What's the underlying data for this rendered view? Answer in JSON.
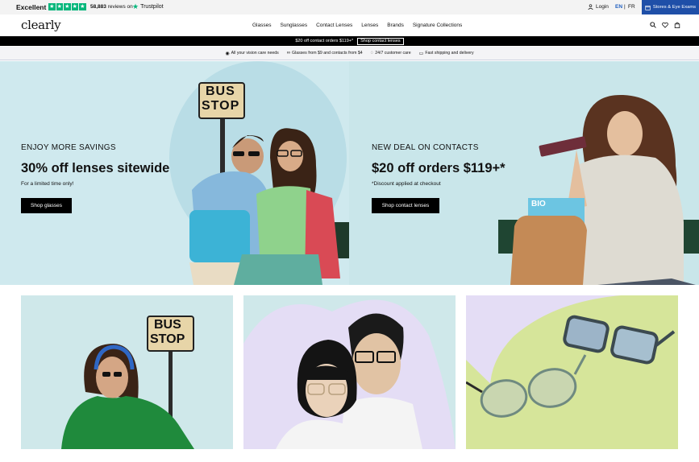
{
  "topbar": {
    "rating": "Excellent",
    "reviews_count": "58,883",
    "reviews_suffix": "reviews on",
    "trustpilot": "Trustpilot",
    "login": "Login",
    "lang_en": "EN",
    "lang_sep": "|",
    "lang_fr": "FR",
    "stores": "Stores & Eye Exams"
  },
  "header": {
    "logo": "clearly",
    "nav": [
      "Glasses",
      "Sunglasses",
      "Contact Lenses",
      "Lenses",
      "Brands",
      "Signature Collections"
    ],
    "icons": [
      "search-icon",
      "heart-icon",
      "bag-icon"
    ]
  },
  "promo": {
    "text": "$20 off contact orders $119+*",
    "button": "Shop contact lenses"
  },
  "benefits": [
    {
      "icon": "eye-icon",
      "text": "All your vision care needs"
    },
    {
      "icon": "glasses-icon",
      "text": "Glasses from $9 and contacts from $4"
    },
    {
      "icon": "headset-icon",
      "text": "24/7 customer care"
    },
    {
      "icon": "box-icon",
      "text": "Fast shipping and delivery"
    }
  ],
  "hero_left": {
    "eyebrow": "ENJOY MORE SAVINGS",
    "title": "30% off lenses sitewide",
    "sub": "For a limited time only!",
    "button": "Shop glasses",
    "sign": [
      "BUS",
      "STOP"
    ]
  },
  "hero_right": {
    "eyebrow": "NEW DEAL ON CONTACTS",
    "title": "$20 off orders $119+*",
    "sub": "*Discount applied at checkout",
    "button": "Shop contact lenses",
    "box_text": "BIO"
  },
  "cards": {
    "card1_sign": [
      "BUS",
      "STOP"
    ]
  },
  "colors": {
    "trustpilot_green": "#00b67a",
    "stores_blue": "#1f4fa8",
    "hero_bg": "#cfe9ee",
    "card2_bg": "#e4ddf5",
    "card3_bg": "#d6e59a"
  }
}
